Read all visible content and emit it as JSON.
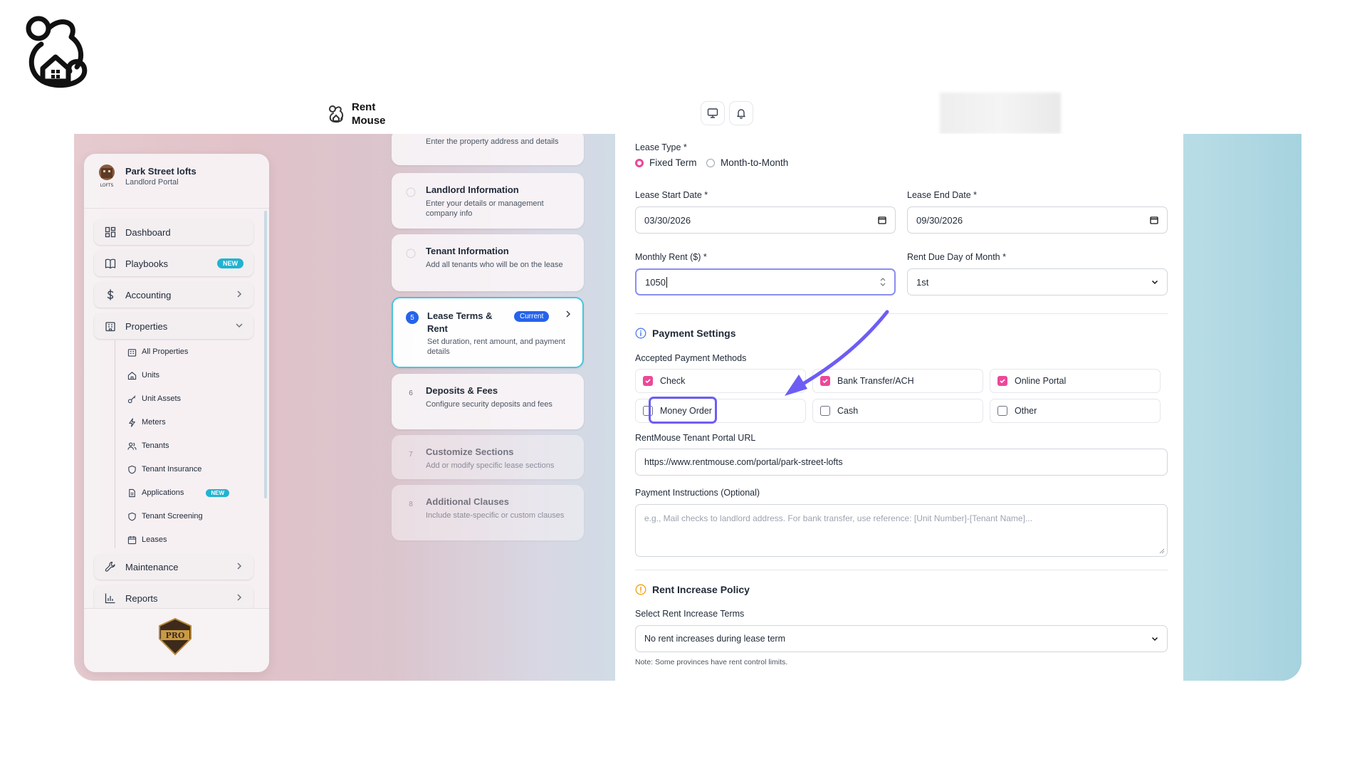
{
  "brand": {
    "name_line1": "Rent",
    "name_line2": "Mouse"
  },
  "sidebar": {
    "org_name": "Park Street lofts",
    "org_sub": "Landlord Portal",
    "logo_text": "LOFTS",
    "nav": [
      {
        "label": "Dashboard",
        "icon": "dashboard-icon"
      },
      {
        "label": "Playbooks",
        "icon": "book-icon",
        "badge": "NEW"
      },
      {
        "label": "Accounting",
        "icon": "dollar-icon"
      },
      {
        "label": "Properties",
        "icon": "building-icon"
      }
    ],
    "sub": [
      {
        "label": "All Properties",
        "icon": "buildings-icon"
      },
      {
        "label": "Units",
        "icon": "home-icon"
      },
      {
        "label": "Unit Assets",
        "icon": "key-icon"
      },
      {
        "label": "Meters",
        "icon": "lightning-icon"
      },
      {
        "label": "Tenants",
        "icon": "users-icon"
      },
      {
        "label": "Tenant Insurance",
        "icon": "shield-icon"
      },
      {
        "label": "Applications",
        "icon": "document-icon",
        "badge": "NEW"
      },
      {
        "label": "Tenant Screening",
        "icon": "shield-icon"
      },
      {
        "label": "Leases",
        "icon": "calendar-icon"
      }
    ],
    "nav_bottom": [
      {
        "label": "Maintenance",
        "icon": "wrench-icon"
      },
      {
        "label": "Reports",
        "icon": "bar-chart-icon"
      }
    ],
    "pro_badge_text": "PRO"
  },
  "steps": [
    {
      "num": "",
      "title": "",
      "desc": "Enter the property address and details"
    },
    {
      "num": "",
      "title": "Landlord Information",
      "desc": "Enter your details or management company info"
    },
    {
      "num": "",
      "title": "Tenant Information",
      "desc": "Add all tenants who will be on the lease"
    },
    {
      "num": "5",
      "title": "Lease Terms & Rent",
      "desc": "Set duration, rent amount, and payment details",
      "badge": "Current"
    },
    {
      "num": "6",
      "title": "Deposits & Fees",
      "desc": "Configure security deposits and fees"
    },
    {
      "num": "7",
      "title": "Customize Sections",
      "desc": "Add or modify specific lease sections"
    },
    {
      "num": "8",
      "title": "Additional Clauses",
      "desc": "Include state-specific or custom clauses"
    }
  ],
  "form": {
    "lease_type_label": "Lease Type *",
    "lease_type_options": [
      "Fixed Term",
      "Month-to-Month"
    ],
    "lease_type_selected": "Fixed Term",
    "start_label": "Lease Start Date *",
    "start_value": "03/30/2026",
    "end_label": "Lease End Date *",
    "end_value": "09/30/2026",
    "rent_label": "Monthly Rent ($) *",
    "rent_value": "1050",
    "due_label": "Rent Due Day of Month *",
    "due_value": "1st",
    "payment_title": "Payment Settings",
    "methods_label": "Accepted Payment Methods",
    "methods": [
      {
        "label": "Check",
        "checked": true
      },
      {
        "label": "Bank Transfer/ACH",
        "checked": true
      },
      {
        "label": "Online Portal",
        "checked": true
      },
      {
        "label": "Money Order",
        "checked": false
      },
      {
        "label": "Cash",
        "checked": false
      },
      {
        "label": "Other",
        "checked": false
      }
    ],
    "portal_label": "RentMouse Tenant Portal URL",
    "portal_value": "https://www.rentmouse.com/portal/park-street-lofts",
    "instructions_label": "Payment Instructions (Optional)",
    "instructions_placeholder": "e.g., Mail checks to landlord address. For bank transfer, use reference: [Unit Number]-[Tenant Name]...",
    "increase_title": "Rent Increase Policy",
    "increase_label": "Select Rent Increase Terms",
    "increase_value": "No rent increases during lease term",
    "increase_note": "Note: Some provinces have rent control limits."
  },
  "colors": {
    "accent": "#ec4899",
    "highlight": "#6d5df5",
    "badge": "#22b3d1",
    "current": "#2563eb"
  }
}
